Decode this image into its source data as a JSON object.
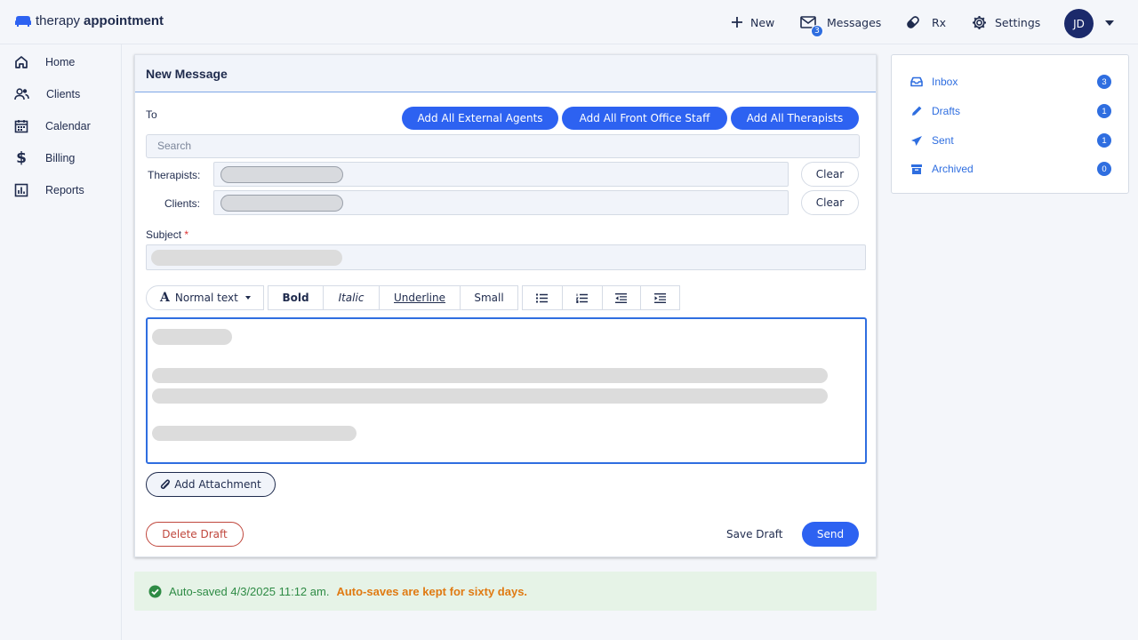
{
  "brand": {
    "name_light": "therapy",
    "name_bold": "appointment"
  },
  "topnav": {
    "new_label": "New",
    "messages_label": "Messages",
    "messages_badge": "3",
    "rx_label": "Rx",
    "settings_label": "Settings",
    "avatar_initials": "JD"
  },
  "sidebar": {
    "items": [
      {
        "label": "Home",
        "icon": "home-icon"
      },
      {
        "label": "Clients",
        "icon": "clients-icon"
      },
      {
        "label": "Calendar",
        "icon": "calendar-icon"
      },
      {
        "label": "Billing",
        "icon": "dollar-icon"
      },
      {
        "label": "Reports",
        "icon": "reports-icon"
      }
    ]
  },
  "compose": {
    "title": "New Message",
    "to_label": "To",
    "add_external_label": "Add All External Agents",
    "add_front_office_label": "Add All Front Office Staff",
    "add_therapists_label": "Add All Therapists",
    "search_placeholder": "Search",
    "therapists_label": "Therapists:",
    "clients_label": "Clients:",
    "clear_label": "Clear",
    "subject_label": "Subject",
    "subject_required": "*",
    "toolbar": {
      "normal_text": "Normal text",
      "bold": "Bold",
      "italic": "Italic",
      "underline": "Underline",
      "small": "Small"
    },
    "add_attachment_label": "Add Attachment",
    "delete_draft_label": "Delete Draft",
    "save_draft_label": "Save Draft",
    "send_label": "Send"
  },
  "autosave": {
    "text": "Auto-saved 4/3/2025 11:12 am.",
    "note": "Auto-saves are kept for sixty days."
  },
  "folders": [
    {
      "label": "Inbox",
      "count": "3",
      "icon": "inbox-icon"
    },
    {
      "label": "Drafts",
      "count": "1",
      "icon": "pencil-icon"
    },
    {
      "label": "Sent",
      "count": "1",
      "icon": "paper-plane-icon"
    },
    {
      "label": "Archived",
      "count": "0",
      "icon": "archive-icon"
    }
  ],
  "colors": {
    "accent": "#2d62f1",
    "navy": "#1f2b4d",
    "danger": "#c0473d",
    "success": "#2e8b45",
    "warning": "#e07a12"
  }
}
